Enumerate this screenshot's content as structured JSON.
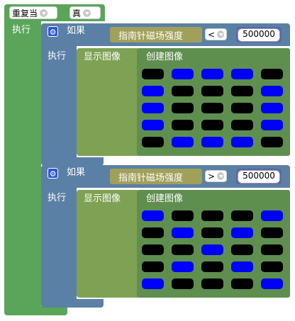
{
  "repeat": {
    "label": "重复当",
    "condition": "真",
    "do_label": "执行"
  },
  "if_blocks": [
    {
      "if_label": "如果",
      "sensor_label": "指南针磁场强度",
      "operator": "<",
      "threshold": "500000",
      "do_label": "执行",
      "show_label": "显示图像",
      "create_label": "创建图像",
      "grid": [
        [
          0,
          1,
          1,
          1,
          0
        ],
        [
          1,
          0,
          0,
          0,
          1
        ],
        [
          1,
          0,
          0,
          0,
          1
        ],
        [
          1,
          0,
          0,
          0,
          1
        ],
        [
          0,
          1,
          1,
          1,
          0
        ]
      ]
    },
    {
      "if_label": "如果",
      "sensor_label": "指南针磁场强度",
      "operator": ">",
      "threshold": "500000",
      "do_label": "执行",
      "show_label": "显示图像",
      "create_label": "创建图像",
      "grid": [
        [
          1,
          0,
          0,
          0,
          1
        ],
        [
          0,
          1,
          0,
          1,
          0
        ],
        [
          0,
          0,
          1,
          0,
          0
        ],
        [
          0,
          1,
          0,
          1,
          0
        ],
        [
          1,
          0,
          0,
          0,
          1
        ]
      ]
    }
  ],
  "colors": {
    "on": "#0000ff",
    "off": "#000000",
    "loop": "#5ba55b",
    "logic": "#5b80a5",
    "display": "#7ea154",
    "sensor": "#a0a05a",
    "math": "#5b67a5"
  }
}
